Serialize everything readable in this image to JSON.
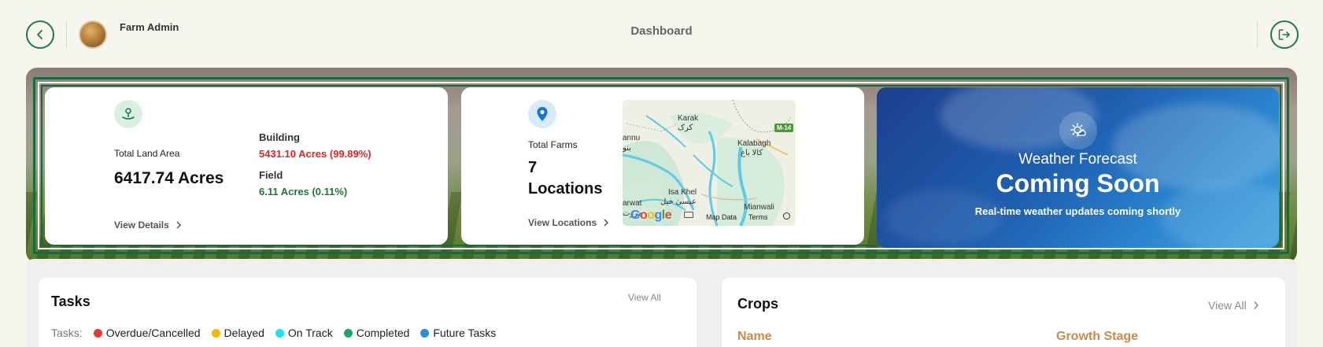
{
  "header": {
    "user_name": "Farm Admin",
    "page_title": "Dashboard"
  },
  "land_card": {
    "label": "Total Land Area",
    "value": "6417.74 Acres",
    "building_label": "Building",
    "building_value": "5431.10 Acres (99.89%)",
    "field_label": "Field",
    "field_value": "6.11 Acres (0.11%)",
    "link": "View Details"
  },
  "farms_card": {
    "label": "Total Farms",
    "count": "7",
    "unit": "Locations",
    "link": "View Locations",
    "map": {
      "places": [
        "Karak",
        "کرک",
        "Kalabagh",
        "کالا باغ",
        "annu",
        "بنو",
        "Isa Khel",
        "عیسیٰ خیل",
        "arwat",
        "مروت",
        "Mianwali"
      ],
      "road_badge": "M-14",
      "logo": "Google",
      "footer": [
        "Map Data",
        "Terms"
      ]
    }
  },
  "weather_card": {
    "title": "Weather Forecast",
    "headline": "Coming Soon",
    "subtitle": "Real-time weather updates coming shortly"
  },
  "tasks": {
    "title": "Tasks",
    "view_all": "View All",
    "legend_label": "Tasks:",
    "legend": [
      {
        "label": "Overdue/Cancelled",
        "color": "#e53935"
      },
      {
        "label": "Delayed",
        "color": "#f5b800"
      },
      {
        "label": "On Track",
        "color": "#19e3ec"
      },
      {
        "label": "Completed",
        "color": "#1aa56b"
      },
      {
        "label": "Future Tasks",
        "color": "#2a8fd6"
      }
    ]
  },
  "crops": {
    "title": "Crops",
    "view_all": "View All",
    "columns": [
      "Name",
      "Growth Stage"
    ]
  },
  "colors": {
    "brand_green": "#1f7a45",
    "alert_red": "#e02424",
    "ok_green": "#1d7a33",
    "column_orange": "#c98a4c"
  }
}
